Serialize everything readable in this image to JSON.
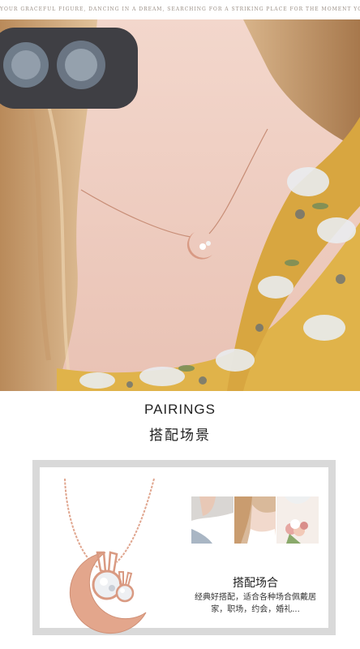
{
  "tagline": "YOUR GRACEFUL FIGURE, DANCING IN A DREAM, SEARCHING FOR A STRIKING PLACE FOR THE MOMENT YOU PUT ON YOUR CROWN, YOU WILL BELONG TO POSSIBLE.",
  "section": {
    "title": "PAIRINGS",
    "subtitle": "搭配场景"
  },
  "scene": {
    "title": "搭配场合",
    "description": "经典好搭配，适合各种场合佩戴居家，职场，约会，婚礼..."
  },
  "colors": {
    "rose_gold": "#e0a68f",
    "frame_gray": "#d9d9d9",
    "dress_yellow": "#e0b34a"
  }
}
